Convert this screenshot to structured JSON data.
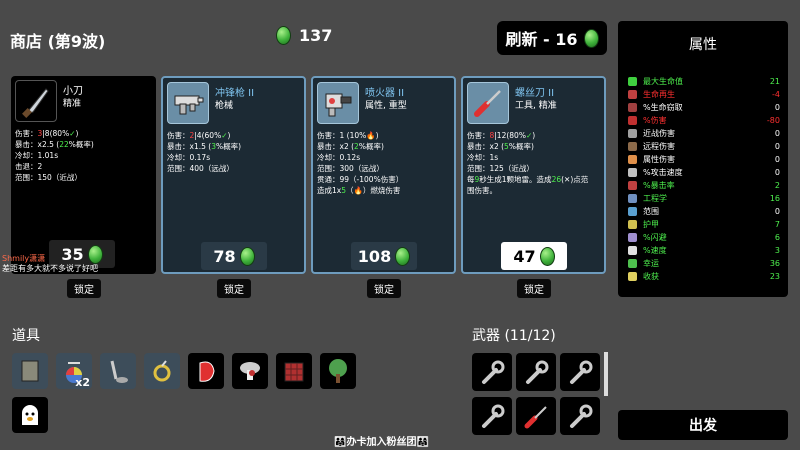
{
  "header": {
    "title": "商店 (第9波)",
    "materials": "137",
    "reroll_label": "刷新 - 16"
  },
  "cards": [
    {
      "name": "小刀",
      "cls": "精准",
      "price": "35",
      "lock": "锁定",
      "icon": "knife-icon",
      "stats": [
        [
          [
            "伤害：",
            ""
          ],
          [
            "3",
            "red"
          ],
          [
            "|8",
            ""
          ],
          [
            "(80%",
            ""
          ],
          [
            "✓",
            "grn"
          ],
          [
            ")",
            ""
          ]
        ],
        [
          [
            "暴击：x2.5 (",
            ""
          ],
          [
            "22",
            "grn"
          ],
          [
            "%概率)",
            ""
          ]
        ],
        [
          [
            "冷却：1.01s",
            ""
          ]
        ],
        [
          [
            "击退：2",
            ""
          ]
        ],
        [
          [
            "范围：150（近战）",
            ""
          ]
        ]
      ]
    },
    {
      "name": "冲锋枪 II",
      "cls": "枪械",
      "price": "78",
      "lock": "锁定",
      "icon": "smg-icon",
      "stats": [
        [
          [
            "伤害：",
            ""
          ],
          [
            "2",
            "red"
          ],
          [
            "|4",
            ""
          ],
          [
            "(60%",
            ""
          ],
          [
            "✓",
            "grn"
          ],
          [
            ")",
            ""
          ]
        ],
        [
          [
            "暴击：x1.5 (",
            ""
          ],
          [
            "3",
            "grn"
          ],
          [
            "%概率)",
            ""
          ]
        ],
        [
          [
            "冷却：0.17s",
            ""
          ]
        ],
        [
          [
            "范围：400（远战）",
            ""
          ]
        ]
      ]
    },
    {
      "name": "喷火器 II",
      "cls": "属性, 重型",
      "price": "108",
      "lock": "锁定",
      "icon": "flamethrower-icon",
      "stats": [
        [
          [
            "伤害：1 (10%",
            ""
          ],
          [
            "🔥",
            "red"
          ],
          [
            ")",
            ""
          ]
        ],
        [
          [
            "暴击：x2 (",
            ""
          ],
          [
            "2",
            "grn"
          ],
          [
            "%概率)",
            ""
          ]
        ],
        [
          [
            "冷却：0.12s",
            ""
          ]
        ],
        [
          [
            "范围：300（远战）",
            ""
          ]
        ],
        [
          [
            "贯通：99（-100%伤害）",
            ""
          ]
        ],
        [
          [
            "造成1x",
            ""
          ],
          [
            "5",
            "grn"
          ],
          [
            "（",
            ""
          ],
          [
            "🔥",
            "red"
          ],
          [
            "）燃烧伤害",
            ""
          ]
        ]
      ]
    },
    {
      "name": "螺丝刀 II",
      "cls": "工具, 精准",
      "price": "47",
      "lock": "锁定",
      "icon": "screwdriver-icon",
      "stats": [
        [
          [
            "伤害：",
            ""
          ],
          [
            "8",
            "red"
          ],
          [
            "|12",
            ""
          ],
          [
            "(80%",
            ""
          ],
          [
            "✓",
            "grn"
          ],
          [
            ")",
            ""
          ]
        ],
        [
          [
            "暴击：x2 (",
            ""
          ],
          [
            "5",
            "grn"
          ],
          [
            "%概率)",
            ""
          ]
        ],
        [
          [
            "冷却：1s",
            ""
          ]
        ],
        [
          [
            "范围：125（近战）",
            ""
          ]
        ],
        [
          [
            "每",
            ""
          ],
          [
            "9",
            "grn"
          ],
          [
            "秒生成1颗地雷。造成",
            ""
          ],
          [
            "26",
            "grn"
          ],
          [
            "(",
            ""
          ],
          [
            "✕",
            ""
          ],
          [
            ")点范",
            ""
          ]
        ],
        [
          [
            "围伤害。",
            ""
          ]
        ]
      ]
    }
  ],
  "chat": {
    "user": "Shmily潇潇",
    "msg": "差距有多大就不多说了好吧"
  },
  "stats_panel": {
    "title": "属性",
    "rows": [
      {
        "label": "最大生命值",
        "value": "21",
        "color": "#4ef04e",
        "ic": "#3fcf3f"
      },
      {
        "label": "生命再生",
        "value": "-4",
        "color": "#ff3030",
        "ic": "#c04040"
      },
      {
        "label": "%生命窃取",
        "value": "0",
        "color": "#ffffff",
        "ic": "#a04040"
      },
      {
        "label": "%伤害",
        "value": "-80",
        "color": "#ff3030",
        "ic": "#c03030"
      },
      {
        "label": "近战伤害",
        "value": "0",
        "color": "#ffffff",
        "ic": "#a0a0a0"
      },
      {
        "label": "远程伤害",
        "value": "0",
        "color": "#ffffff",
        "ic": "#8c6a4a"
      },
      {
        "label": "属性伤害",
        "value": "0",
        "color": "#ffffff",
        "ic": "#e0904a"
      },
      {
        "label": "%攻击速度",
        "value": "0",
        "color": "#ffffff",
        "ic": "#c0c0c0"
      },
      {
        "label": "%暴击率",
        "value": "2",
        "color": "#4ef04e",
        "ic": "#c04040"
      },
      {
        "label": "工程学",
        "value": "16",
        "color": "#4ef04e",
        "ic": "#7090c0"
      },
      {
        "label": "范围",
        "value": "0",
        "color": "#ffffff",
        "ic": "#5aa0d0"
      },
      {
        "label": "护甲",
        "value": "7",
        "color": "#4ef04e",
        "ic": "#d0c050"
      },
      {
        "label": "%闪避",
        "value": "6",
        "color": "#4ef04e",
        "ic": "#a090d0"
      },
      {
        "label": "%速度",
        "value": "3",
        "color": "#4ef04e",
        "ic": "#e0e0e0"
      },
      {
        "label": "幸运",
        "value": "36",
        "color": "#4ef04e",
        "ic": "#4ec04e"
      },
      {
        "label": "收获",
        "value": "23",
        "color": "#4ef04e",
        "ic": "#e0d060"
      }
    ]
  },
  "items_section": {
    "title": "道具",
    "items": [
      {
        "name": "vest-item-icon",
        "t2": true,
        "count": ""
      },
      {
        "name": "propeller-hat-item-icon",
        "t2": true,
        "count": "x2"
      },
      {
        "name": "metal-detector-item-icon",
        "t2": true,
        "count": ""
      },
      {
        "name": "lens-item-icon",
        "t2": true,
        "count": ""
      },
      {
        "name": "red-gem-item-icon",
        "t2": false,
        "count": ""
      },
      {
        "name": "mushroom-item-icon",
        "t2": false,
        "count": ""
      },
      {
        "name": "plaid-shirt-item-icon",
        "t2": false,
        "count": ""
      },
      {
        "name": "tree-item-icon",
        "t2": false,
        "count": ""
      },
      {
        "name": "ghost-item-icon",
        "t2": false,
        "count": ""
      }
    ]
  },
  "weapons_section": {
    "title": "武器 (11/12)"
  },
  "go_label": "出发",
  "banner": "👨‍👩‍👧办卡加入粉丝团👨‍👩‍👧"
}
